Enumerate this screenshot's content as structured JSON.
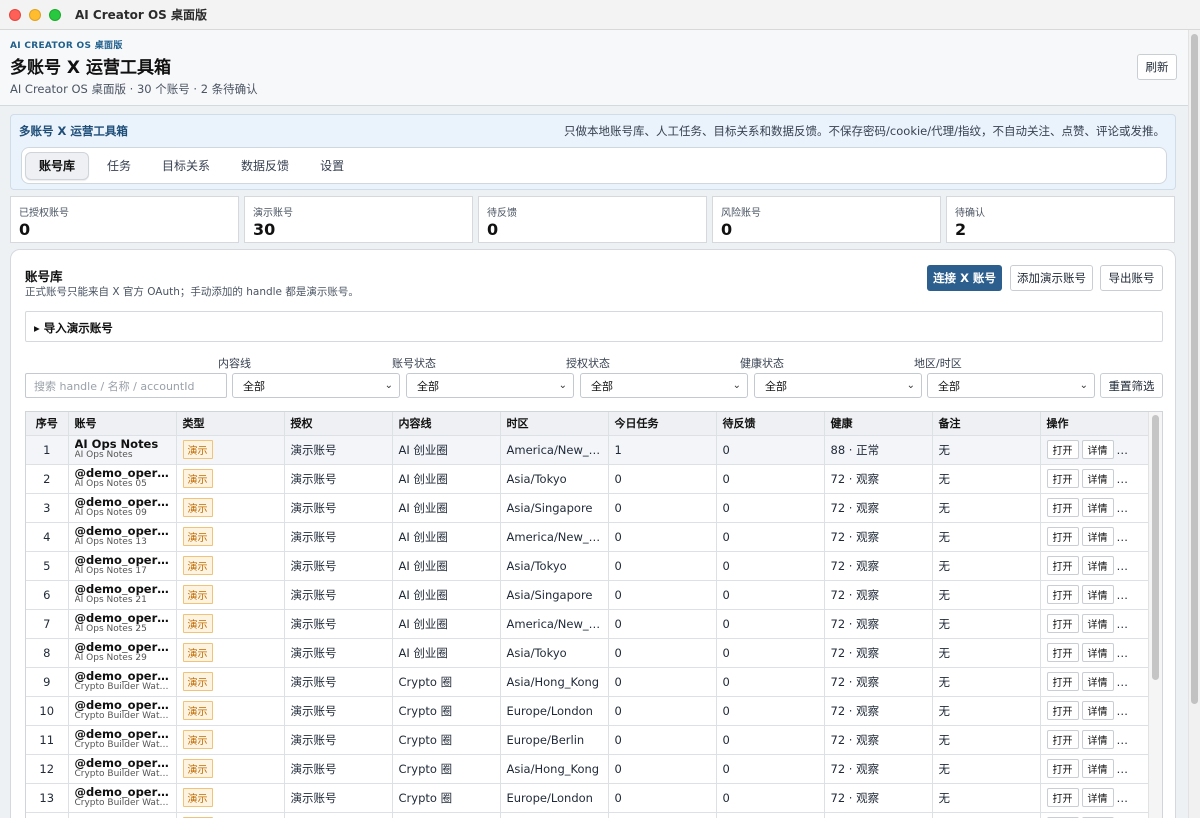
{
  "window": {
    "title": "AI Creator OS 桌面版"
  },
  "header": {
    "eyebrow": "AI CREATOR OS 桌面版",
    "title": "多账号 X 运营工具箱",
    "subtitle": "AI Creator OS 桌面版 · 30 个账号 · 2 条待确认",
    "refresh_label": "刷新"
  },
  "toolbox": {
    "title": "多账号 X 运营工具箱",
    "note": "只做本地账号库、人工任务、目标关系和数据反馈。不保存密码/cookie/代理/指纹，不自动关注、点赞、评论或发推。",
    "tabs": [
      "账号库",
      "任务",
      "目标关系",
      "数据反馈",
      "设置"
    ],
    "active_tab": "账号库"
  },
  "stats": [
    {
      "label": "已授权账号",
      "value": "0"
    },
    {
      "label": "演示账号",
      "value": "30"
    },
    {
      "label": "待反馈",
      "value": "0"
    },
    {
      "label": "风险账号",
      "value": "0"
    },
    {
      "label": "待确认",
      "value": "2"
    }
  ],
  "library": {
    "title": "账号库",
    "subtitle": "正式账号只能来自 X 官方 OAuth；手动添加的 handle 都是演示账号。",
    "connect_label": "连接 X 账号",
    "add_demo_label": "添加演示账号",
    "export_label": "导出账号",
    "import_summary": "▸ 导入演示账号"
  },
  "filters": {
    "search_placeholder": "搜索 handle / 名称 / accountId",
    "content_line": {
      "label": "内容线",
      "value": "全部"
    },
    "account_status": {
      "label": "账号状态",
      "value": "全部"
    },
    "auth_status": {
      "label": "授权状态",
      "value": "全部"
    },
    "health_status": {
      "label": "健康状态",
      "value": "全部"
    },
    "region": {
      "label": "地区/时区",
      "value": "全部"
    },
    "reset_label": "重置筛选"
  },
  "table": {
    "columns": [
      "序号",
      "账号",
      "类型",
      "授权",
      "内容线",
      "时区",
      "今日任务",
      "待反馈",
      "健康",
      "备注",
      "操作"
    ],
    "op_labels": [
      "打开",
      "详情",
      "任务"
    ],
    "rows": [
      {
        "no": "1",
        "handle": "AI Ops Notes",
        "name": "AI Ops Notes",
        "type": "演示",
        "auth": "演示账号",
        "line": "AI 创业圈",
        "tz": "America/New_York",
        "today": "1",
        "pending": "0",
        "health": "88 · 正常",
        "note": "无"
      },
      {
        "no": "2",
        "handle": "@demo_operat...",
        "name": "AI Ops Notes 05",
        "type": "演示",
        "auth": "演示账号",
        "line": "AI 创业圈",
        "tz": "Asia/Tokyo",
        "today": "0",
        "pending": "0",
        "health": "72 · 观察",
        "note": "无"
      },
      {
        "no": "3",
        "handle": "@demo_operat...",
        "name": "AI Ops Notes 09",
        "type": "演示",
        "auth": "演示账号",
        "line": "AI 创业圈",
        "tz": "Asia/Singapore",
        "today": "0",
        "pending": "0",
        "health": "72 · 观察",
        "note": "无"
      },
      {
        "no": "4",
        "handle": "@demo_operat...",
        "name": "AI Ops Notes 13",
        "type": "演示",
        "auth": "演示账号",
        "line": "AI 创业圈",
        "tz": "America/New_York",
        "today": "0",
        "pending": "0",
        "health": "72 · 观察",
        "note": "无"
      },
      {
        "no": "5",
        "handle": "@demo_operat...",
        "name": "AI Ops Notes 17",
        "type": "演示",
        "auth": "演示账号",
        "line": "AI 创业圈",
        "tz": "Asia/Tokyo",
        "today": "0",
        "pending": "0",
        "health": "72 · 观察",
        "note": "无"
      },
      {
        "no": "6",
        "handle": "@demo_operat...",
        "name": "AI Ops Notes 21",
        "type": "演示",
        "auth": "演示账号",
        "line": "AI 创业圈",
        "tz": "Asia/Singapore",
        "today": "0",
        "pending": "0",
        "health": "72 · 观察",
        "note": "无"
      },
      {
        "no": "7",
        "handle": "@demo_operat...",
        "name": "AI Ops Notes 25",
        "type": "演示",
        "auth": "演示账号",
        "line": "AI 创业圈",
        "tz": "America/New_York",
        "today": "0",
        "pending": "0",
        "health": "72 · 观察",
        "note": "无"
      },
      {
        "no": "8",
        "handle": "@demo_operat...",
        "name": "AI Ops Notes 29",
        "type": "演示",
        "auth": "演示账号",
        "line": "AI 创业圈",
        "tz": "Asia/Tokyo",
        "today": "0",
        "pending": "0",
        "health": "72 · 观察",
        "note": "无"
      },
      {
        "no": "9",
        "handle": "@demo_operat...",
        "name": "Crypto Builder Watc...",
        "type": "演示",
        "auth": "演示账号",
        "line": "Crypto 圈",
        "tz": "Asia/Hong_Kong",
        "today": "0",
        "pending": "0",
        "health": "72 · 观察",
        "note": "无"
      },
      {
        "no": "10",
        "handle": "@demo_operat...",
        "name": "Crypto Builder Watc...",
        "type": "演示",
        "auth": "演示账号",
        "line": "Crypto 圈",
        "tz": "Europe/London",
        "today": "0",
        "pending": "0",
        "health": "72 · 观察",
        "note": "无"
      },
      {
        "no": "11",
        "handle": "@demo_operat...",
        "name": "Crypto Builder Watc...",
        "type": "演示",
        "auth": "演示账号",
        "line": "Crypto 圈",
        "tz": "Europe/Berlin",
        "today": "0",
        "pending": "0",
        "health": "72 · 观察",
        "note": "无"
      },
      {
        "no": "12",
        "handle": "@demo_operat...",
        "name": "Crypto Builder Watc...",
        "type": "演示",
        "auth": "演示账号",
        "line": "Crypto 圈",
        "tz": "Asia/Hong_Kong",
        "today": "0",
        "pending": "0",
        "health": "72 · 观察",
        "note": "无"
      },
      {
        "no": "13",
        "handle": "@demo_operat...",
        "name": "Crypto Builder Watc...",
        "type": "演示",
        "auth": "演示账号",
        "line": "Crypto 圈",
        "tz": "Europe/London",
        "today": "0",
        "pending": "0",
        "health": "72 · 观察",
        "note": "无"
      },
      {
        "no": "14",
        "handle": "@demo_operat...",
        "name": "",
        "type": "演示",
        "auth": "演示账号",
        "line": "",
        "tz": "",
        "today": "",
        "pending": "",
        "health": "",
        "note": ""
      }
    ]
  },
  "colors": {
    "primary": "#2c5f8e",
    "badge_text": "#c06b00",
    "badge_bg": "#fdf3e1"
  }
}
